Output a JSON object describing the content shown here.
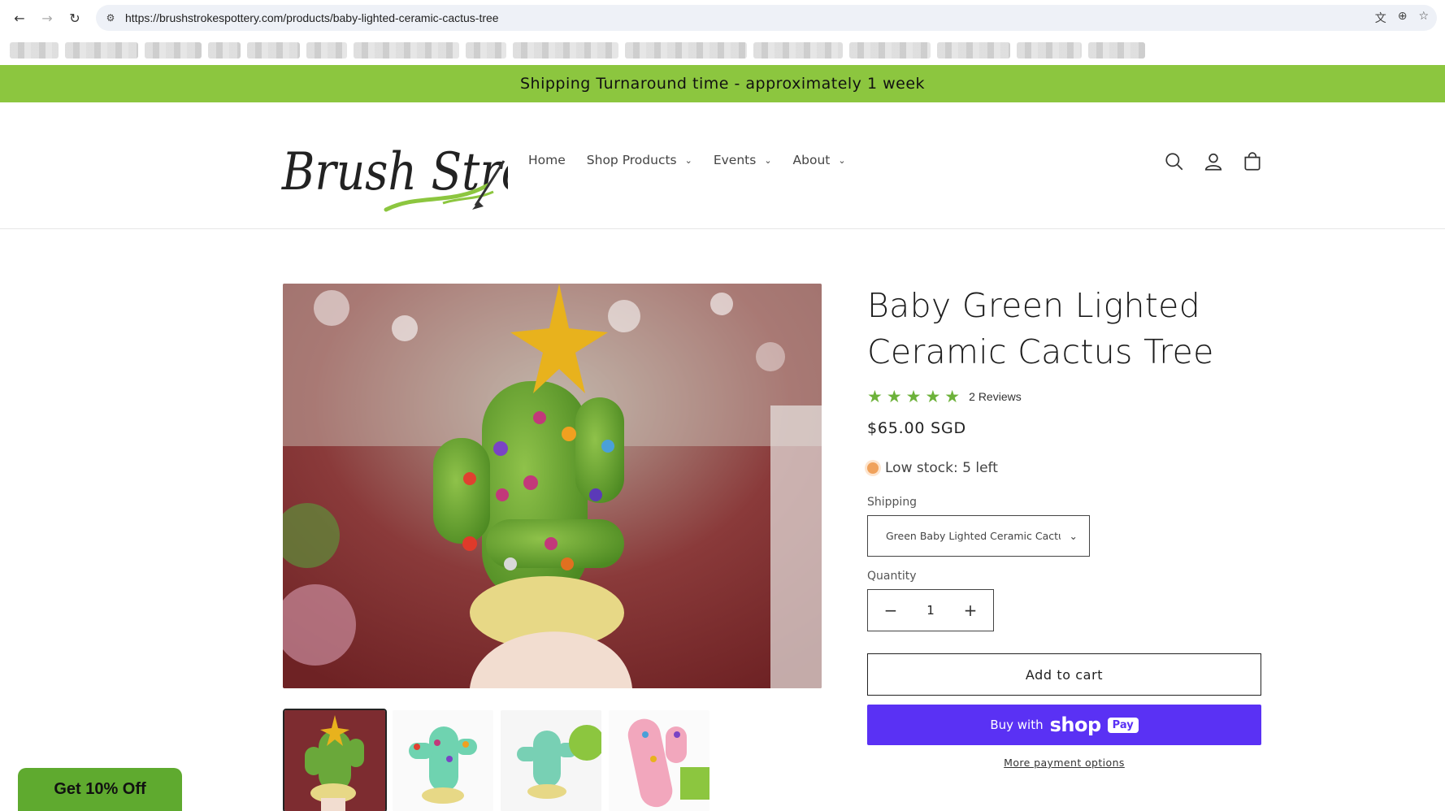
{
  "browser": {
    "url": "https://brushstrokespottery.com/products/baby-lighted-ceramic-cactus-tree"
  },
  "announcement": {
    "text": "Shipping Turnaround time - approximately 1 week"
  },
  "header": {
    "logo_text": "BrushStrokes",
    "nav": [
      {
        "label": "Home"
      },
      {
        "label": "Shop Products"
      },
      {
        "label": "Events"
      },
      {
        "label": "About"
      }
    ]
  },
  "product": {
    "title": "Baby Green Lighted Ceramic Cactus Tree",
    "stars": "★★★★★",
    "rating": 5,
    "review_count": "2 Reviews",
    "price": "$65.00 SGD",
    "stock": "Low stock: 5 left",
    "shipping_label": "Shipping",
    "shipping_value": "Green Baby Lighted Ceramic Cactus Tree",
    "quantity_label": "Quantity",
    "quantity": "1",
    "add_to_cart": "Add to cart",
    "buy_with": "Buy with",
    "shop_word": "shop",
    "pay_badge": "Pay",
    "more_payment": "More payment options"
  },
  "popup": {
    "discount": "Get 10% Off"
  },
  "colors": {
    "accent_green": "#8cc63f",
    "star_green": "#6db23a",
    "shop_pay_purple": "#5a31f4",
    "stock_orange": "#f0a25c"
  }
}
